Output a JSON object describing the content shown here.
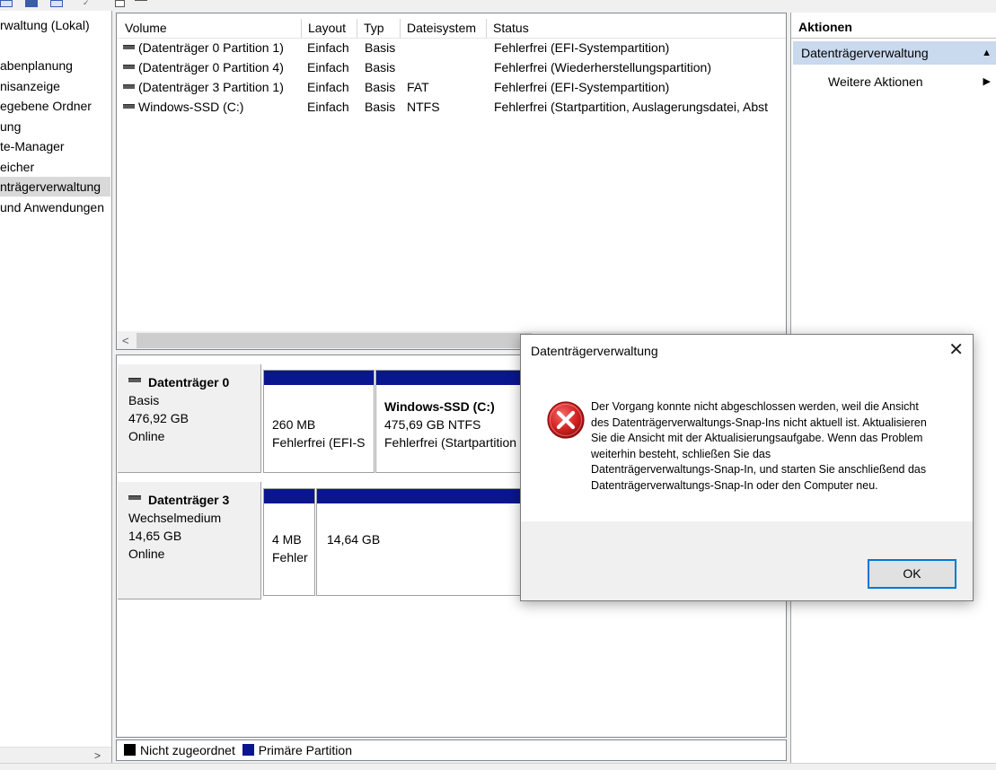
{
  "tree": {
    "items": [
      {
        "label": "rwaltung (Lokal)"
      },
      {
        "label": ""
      },
      {
        "label": "abenplanung"
      },
      {
        "label": "nisanzeige"
      },
      {
        "label": "egebene Ordner"
      },
      {
        "label": "ung"
      },
      {
        "label": "te-Manager"
      },
      {
        "label": "eicher"
      },
      {
        "label": "nträgerverwaltung",
        "selected": true
      },
      {
        "label": "und Anwendungen"
      }
    ]
  },
  "volumes": {
    "columns": [
      "Volume",
      "Layout",
      "Typ",
      "Dateisystem",
      "Status"
    ],
    "rows": [
      {
        "volume": "(Datenträger 0 Partition 1)",
        "layout": "Einfach",
        "typ": "Basis",
        "fs": "",
        "status": "Fehlerfrei (EFI-Systempartition)"
      },
      {
        "volume": "(Datenträger 0 Partition 4)",
        "layout": "Einfach",
        "typ": "Basis",
        "fs": "",
        "status": "Fehlerfrei (Wiederherstellungspartition)"
      },
      {
        "volume": "(Datenträger 3 Partition 1)",
        "layout": "Einfach",
        "typ": "Basis",
        "fs": "FAT",
        "status": "Fehlerfrei (EFI-Systempartition)"
      },
      {
        "volume": "Windows-SSD (C:)",
        "layout": "Einfach",
        "typ": "Basis",
        "fs": "NTFS",
        "status": "Fehlerfrei (Startpartition, Auslagerungsdatei, Abst"
      }
    ]
  },
  "disks": [
    {
      "name": "Datenträger 0",
      "type": "Basis",
      "size": "476,92 GB",
      "state": "Online",
      "partitions": [
        {
          "title": "",
          "line1": "260 MB",
          "line2": "Fehlerfrei (EFI-S"
        },
        {
          "title": "Windows-SSD  (C:)",
          "line1": "475,69 GB NTFS",
          "line2": "Fehlerfrei (Startpartition"
        }
      ]
    },
    {
      "name": "Datenträger 3",
      "type": "Wechselmedium",
      "size": "14,65 GB",
      "state": "Online",
      "partitions": [
        {
          "title": "",
          "line1": "4 MB",
          "line2": "Fehler"
        },
        {
          "title": "",
          "line1": "14,64 GB",
          "line2": ""
        }
      ]
    }
  ],
  "legend": {
    "unallocated": "Nicht zugeordnet",
    "primary": "Primäre Partition",
    "unallocated_color": "#000000",
    "primary_color": "#0a168e"
  },
  "actions": {
    "title": "Aktionen",
    "section": "Datenträgerverwaltung",
    "more": "Weitere Aktionen"
  },
  "dialog": {
    "title": "Datenträgerverwaltung",
    "close_icon": "close-icon",
    "error_icon": "error-icon",
    "message_lines": [
      "Der Vorgang konnte nicht abgeschlossen werden, weil die Ansicht",
      "des Datenträgerverwaltungs-Snap-Ins nicht aktuell ist. Aktualisieren",
      "Sie die Ansicht mit der Aktualisierungsaufgabe. Wenn das Problem",
      "weiterhin besteht, schließen Sie das",
      "Datenträgerverwaltungs-Snap-In, und starten Sie anschließend das",
      "Datenträgerverwaltungs-Snap-In oder den Computer neu."
    ],
    "ok_label": "OK",
    "accent": "#0078d7"
  }
}
